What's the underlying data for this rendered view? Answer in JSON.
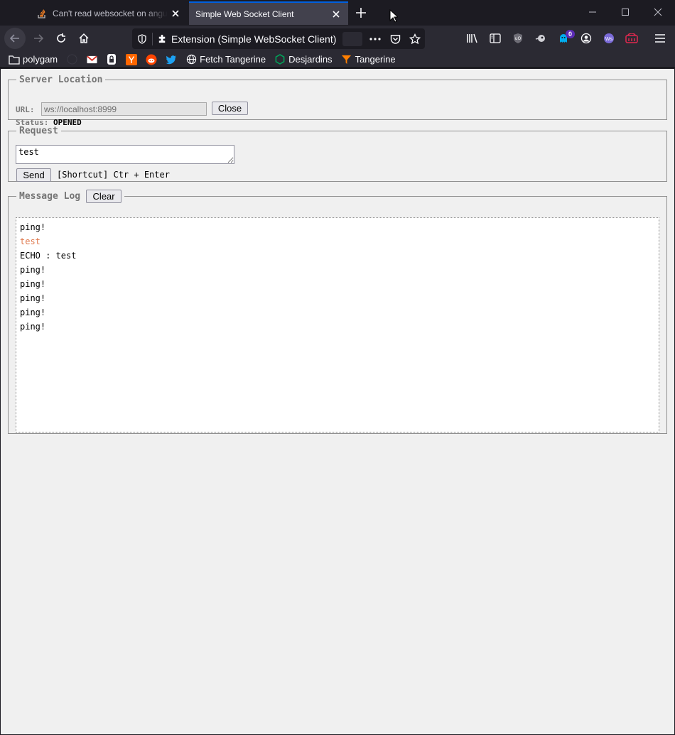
{
  "browser": {
    "tabs": [
      {
        "title": "Can't read websocket on angular",
        "active": false,
        "favicon": "stackoverflow-icon"
      },
      {
        "title": "Simple Web Socket Client",
        "active": true,
        "favicon": null
      }
    ],
    "url": "Extension (Simple WebSocket Client)",
    "badge_count": "0",
    "bookmarks": [
      {
        "label": "polygam",
        "icon": "folder-icon"
      },
      {
        "label": "",
        "icon": "github-icon"
      },
      {
        "label": "",
        "icon": "gmail-icon"
      },
      {
        "label": "",
        "icon": "lock-icon"
      },
      {
        "label": "",
        "icon": "ycombinator-icon"
      },
      {
        "label": "",
        "icon": "reddit-icon"
      },
      {
        "label": "",
        "icon": "twitter-icon"
      },
      {
        "label": "Fetch Tangerine",
        "icon": "globe-icon"
      },
      {
        "label": "Desjardins",
        "icon": "hexagon-icon"
      },
      {
        "label": "Tangerine",
        "icon": "tangerine-icon"
      }
    ]
  },
  "server": {
    "legend": "Server Location",
    "url_label": "URL:",
    "url_value": "ws://localhost:8999",
    "close_label": "Close",
    "status_label": "Status:",
    "status_value": "OPENED"
  },
  "request": {
    "legend": "Request",
    "value": "test",
    "send_label": "Send",
    "shortcut": "[Shortcut] Ctr + Enter"
  },
  "log": {
    "legend": "Message Log",
    "clear_label": "Clear",
    "sent_color": "#e07a4f",
    "messages": [
      {
        "text": "ping!",
        "sent": false
      },
      {
        "text": "test",
        "sent": true
      },
      {
        "text": "ECHO : test",
        "sent": false
      },
      {
        "text": "ping!",
        "sent": false
      },
      {
        "text": "ping!",
        "sent": false
      },
      {
        "text": "ping!",
        "sent": false
      },
      {
        "text": "ping!",
        "sent": false
      },
      {
        "text": "ping!",
        "sent": false
      }
    ]
  }
}
